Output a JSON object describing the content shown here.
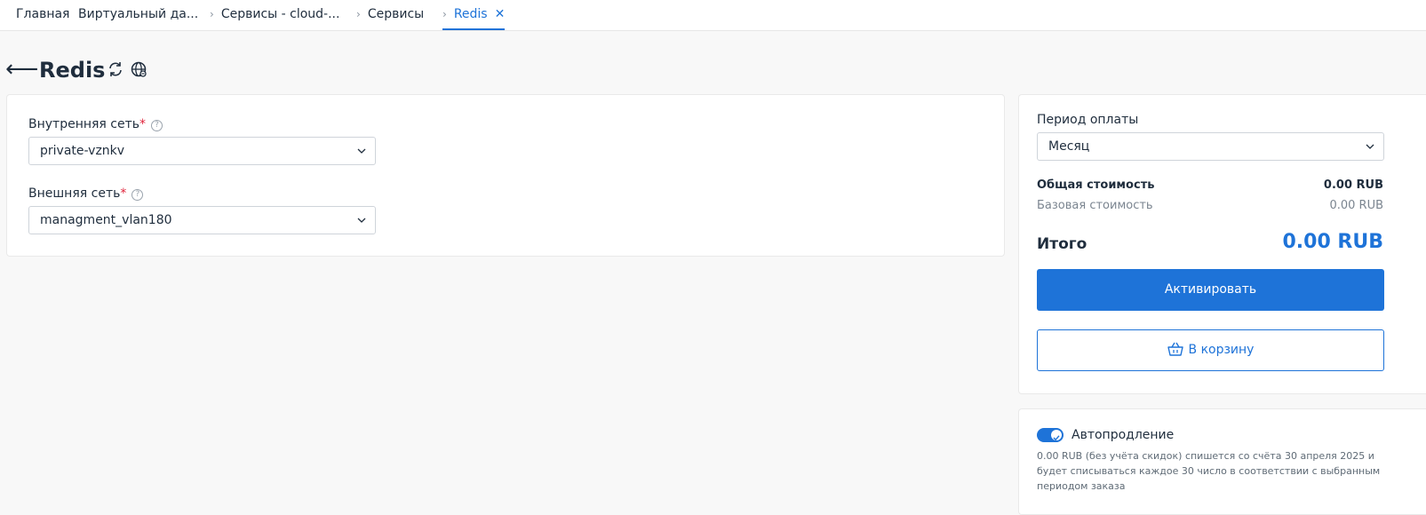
{
  "tabs": [
    {
      "label": "Главная"
    },
    {
      "label": "Виртуальный да..."
    },
    {
      "label": "Сервисы - cloud-..."
    },
    {
      "label": "Сервисы"
    },
    {
      "label": "Redis"
    }
  ],
  "header": {
    "title": "Redis"
  },
  "form": {
    "internal_network": {
      "label": "Внутренняя сеть",
      "required": "*",
      "help": "?",
      "value": "private-vznkv"
    },
    "external_network": {
      "label": "Внешняя сеть",
      "required": "*",
      "help": "?",
      "value": "managment_vlan180"
    }
  },
  "order": {
    "period_label": "Период оплаты",
    "period_value": "Месяц",
    "total_cost_label": "Общая стоимость",
    "total_cost_value": "0.00 RUB",
    "base_cost_label": "Базовая стоимость",
    "base_cost_value": "0.00 RUB",
    "sum_label": "Итого",
    "sum_value": "0.00 RUB",
    "activate_label": "Активировать",
    "cart_label": "В корзину"
  },
  "autorenew": {
    "label": "Автопродление",
    "enabled": true,
    "description": "0.00 RUB (без учёта скидок) спишется со счёта 30 апреля 2025 и будет списываться каждое 30 число в соответствии с выбранным периодом заказа"
  },
  "colors": {
    "accent": "#1e73d8",
    "required": "#e0243b"
  }
}
